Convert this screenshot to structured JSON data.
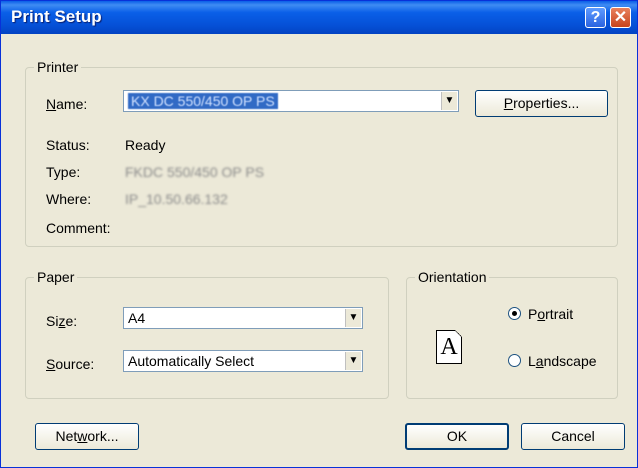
{
  "window": {
    "title": "Print Setup",
    "help_glyph": "?",
    "close_glyph": "✕"
  },
  "printer": {
    "group_label": "Printer",
    "name_label": "Name:",
    "name_value": "KX DC 550/450 OP PS",
    "status_label": "Status:",
    "status_value": "Ready",
    "type_label": "Type:",
    "type_value": "FKDC 550/450 OP PS",
    "where_label": "Where:",
    "where_value": "IP_10.50.66.132",
    "comment_label": "Comment:",
    "comment_value": "",
    "properties_button": "Properties..."
  },
  "paper": {
    "group_label": "Paper",
    "size_label": "Size:",
    "size_value": "A4",
    "source_label": "Source:",
    "source_value": "Automatically Select"
  },
  "orientation": {
    "group_label": "Orientation",
    "icon_letter": "A",
    "portrait_label": "Portrait",
    "landscape_label": "Landscape",
    "selected": "Portrait"
  },
  "buttons": {
    "network": "Network...",
    "ok": "OK",
    "cancel": "Cancel"
  },
  "icons": {
    "dropdown": "dropdown-arrow-icon",
    "help": "help-icon",
    "close": "close-icon"
  },
  "colors": {
    "titlebar": "#0a5fe8",
    "dialog_bg": "#ece9d8",
    "selection": "#316ac5"
  }
}
